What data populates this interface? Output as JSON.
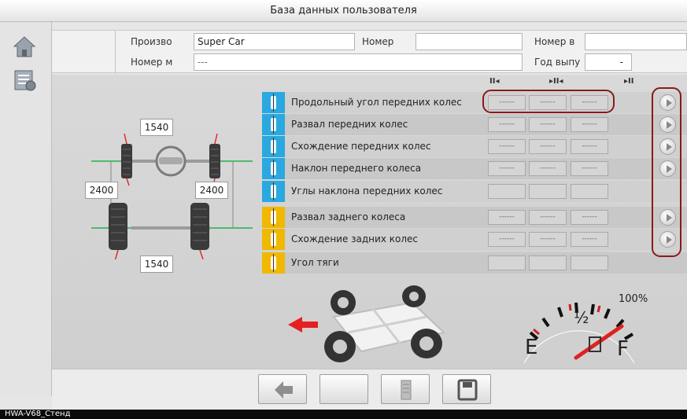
{
  "window": {
    "title": "База данных пользователя"
  },
  "sidebar": {
    "icons": [
      "home-icon",
      "vehicle-database-icon"
    ]
  },
  "header": {
    "manufacturer_label": "Произво",
    "manufacturer_value": "Super Car",
    "number_label": "Номер",
    "number_value": "",
    "number_b_label": "Номер в",
    "number_b_value": "",
    "model_label": "Номер м",
    "model_value": "---",
    "year_label": "Год выпу",
    "year_value": "-"
  },
  "dimensions": {
    "front_track": "1540",
    "rear_track": "1540",
    "wheelbase_left": "2400",
    "wheelbase_right": "2400"
  },
  "table": {
    "columns": [
      "II◂",
      "▸II◂",
      "▸II"
    ],
    "rows": [
      {
        "label": "Продольный угол передних колес",
        "values": [
          "------",
          "------",
          "------"
        ],
        "icon": "caster-icon",
        "group": "front",
        "play": true
      },
      {
        "label": "Развал передних колес",
        "values": [
          "------",
          "------",
          "------"
        ],
        "icon": "front-camber-icon",
        "group": "front",
        "play": true
      },
      {
        "label": "Схождение передних колес",
        "values": [
          "------",
          "------",
          "------"
        ],
        "icon": "front-toe-icon",
        "group": "front",
        "play": true
      },
      {
        "label": "Наклон переднего колеса",
        "values": [
          "------",
          "------",
          "------"
        ],
        "icon": "sai-icon",
        "group": "front",
        "play": true
      },
      {
        "label": "Углы наклона передних колес",
        "values": [
          "",
          "",
          ""
        ],
        "icon": "included-angle-icon",
        "group": "front",
        "play": false
      },
      {
        "label": "Развал заднего колеса",
        "values": [
          "------",
          "------",
          "------"
        ],
        "icon": "rear-camber-icon",
        "group": "rear",
        "play": true
      },
      {
        "label": "Схождение задних колес",
        "values": [
          "------",
          "------",
          "------"
        ],
        "icon": "rear-toe-icon",
        "group": "rear",
        "play": true
      },
      {
        "label": "Угол тяги",
        "values": [
          "",
          "",
          ""
        ],
        "icon": "thrust-angle-icon",
        "group": "rear",
        "play": false
      }
    ]
  },
  "gauge": {
    "empty_label": "E",
    "half_label": "½",
    "full_label": "F",
    "percent_label": "100%",
    "level": 0.0
  },
  "footer": {
    "buttons": [
      "back-arrow-icon",
      "blank",
      "printer-icon",
      "save-icon"
    ]
  },
  "status": {
    "text": "HWA-V68_Стенд"
  },
  "colors": {
    "front_icon_bg": "#2aa8e0",
    "rear_icon_bg": "#f0b800",
    "highlight": "#8b1a1a",
    "needle": "#e02020"
  }
}
